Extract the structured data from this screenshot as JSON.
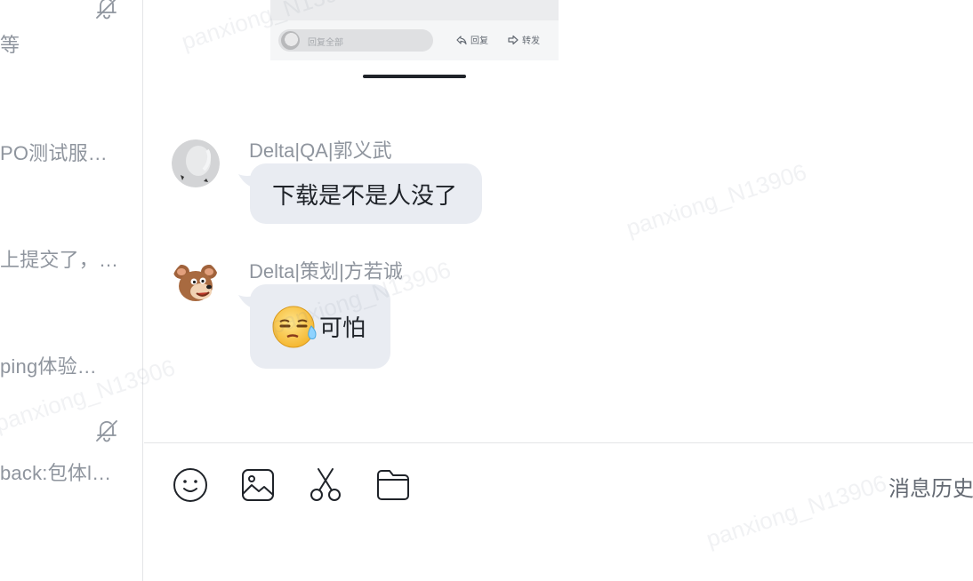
{
  "sidebar": {
    "previews": [
      {
        "text": "等"
      },
      {
        "text": "PO测试服…"
      },
      {
        "text": "上提交了，…"
      },
      {
        "text": "ping体验…"
      },
      {
        "text": "back:包体l…"
      }
    ]
  },
  "card": {
    "reply_placeholder": "回复全部",
    "reply_label": "回复",
    "forward_label": "转发"
  },
  "messages": [
    {
      "sender": "Delta|QA|郭义武",
      "text": "下载是不是人没了"
    },
    {
      "sender": "Delta|策划|方若诚",
      "text": "可怕"
    }
  ],
  "composer": {
    "history_label": "消息历史"
  },
  "watermark": "panxiong_N13906",
  "colors": {
    "bubble": "#e9ecf2",
    "muted_text": "#8f959e",
    "icon": "#1f2329"
  }
}
